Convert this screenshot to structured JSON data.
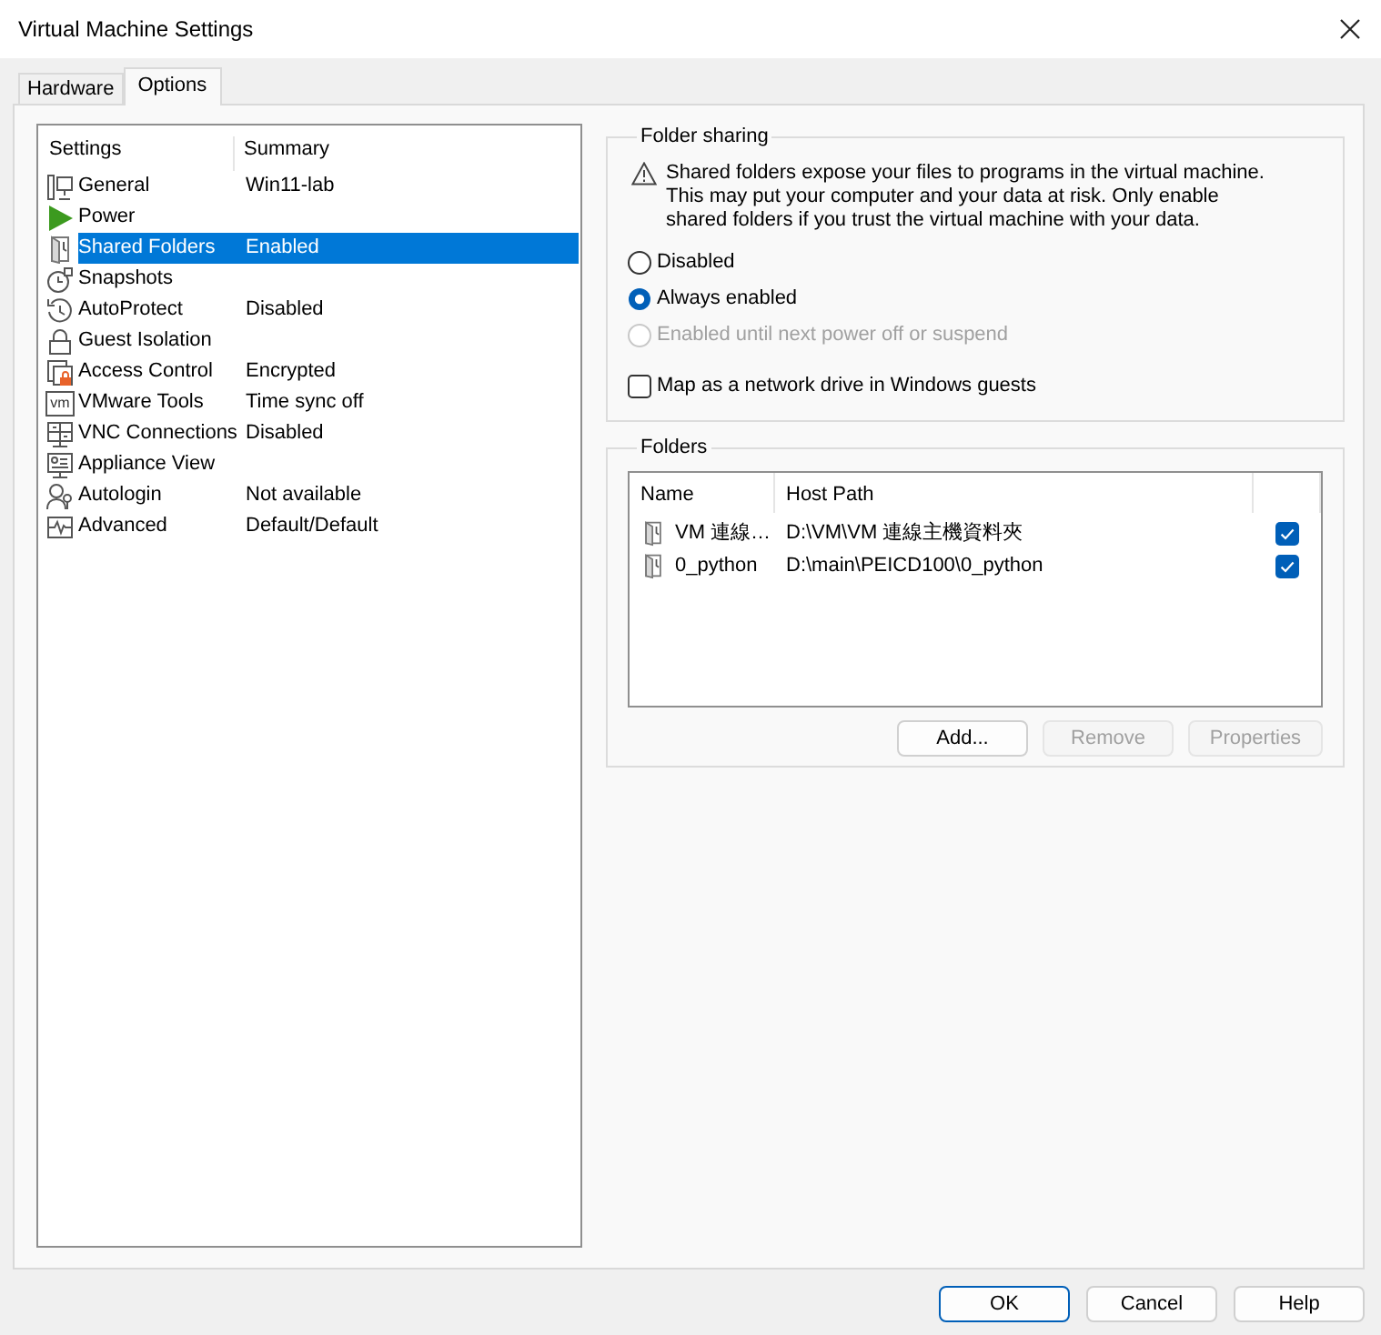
{
  "window": {
    "title": "Virtual Machine Settings"
  },
  "tabs": [
    {
      "label": "Hardware",
      "selected": false
    },
    {
      "label": "Options",
      "selected": true
    }
  ],
  "settings_list": {
    "columns": [
      "Settings",
      "Summary"
    ],
    "items": [
      {
        "kind": "monitor",
        "name": "General",
        "summary": "Win11-lab",
        "selected": false
      },
      {
        "kind": "power",
        "name": "Power",
        "selected": false
      },
      {
        "kind": "folder",
        "name": "Shared Folders",
        "summary": "Enabled",
        "selected": true
      },
      {
        "kind": "snapshot",
        "name": "Snapshots",
        "selected": false
      },
      {
        "kind": "autoprotect",
        "name": "AutoProtect",
        "summary": "Disabled",
        "selected": false
      },
      {
        "kind": "lock",
        "name": "Guest Isolation",
        "selected": false
      },
      {
        "kind": "access",
        "name": "Access Control",
        "summary": "Encrypted",
        "selected": false
      },
      {
        "kind": "tools",
        "name": "VMware Tools",
        "summary": "Time sync off",
        "icon_text": "vm",
        "selected": false
      },
      {
        "kind": "vnc",
        "name": "VNC Connections",
        "summary": "Disabled",
        "selected": false
      },
      {
        "kind": "appliance",
        "name": "Appliance View",
        "selected": false
      },
      {
        "kind": "autologin",
        "name": "Autologin",
        "summary": "Not available",
        "selected": false
      },
      {
        "kind": "advanced",
        "name": "Advanced",
        "summary": "Default/Default",
        "selected": false
      }
    ]
  },
  "folder_sharing": {
    "title": "Folder sharing",
    "warning": "Shared folders expose your files to programs in the virtual machine. This may put your computer and your data at risk. Only enable shared folders if you trust the virtual machine with your data.",
    "options": [
      {
        "label": "Disabled",
        "selected": false,
        "disabled": false
      },
      {
        "label": "Always enabled",
        "selected": true,
        "disabled": false
      },
      {
        "label": "Enabled until next power off or suspend",
        "selected": false,
        "disabled": true
      }
    ],
    "map_drive": {
      "label": "Map as a network drive in Windows guests",
      "checked": false
    }
  },
  "folders": {
    "title": "Folders",
    "columns": [
      "Name",
      "Host Path"
    ],
    "rows": [
      {
        "name": "VM 連線…",
        "host_path": "D:\\VM\\VM 連線主機資料夾",
        "checked": true
      },
      {
        "name": "0_python",
        "host_path": "D:\\main\\PEICD100\\0_python",
        "checked": true
      }
    ],
    "buttons": [
      {
        "label": "Add...",
        "disabled": false
      },
      {
        "label": "Remove",
        "disabled": true
      },
      {
        "label": "Properties",
        "disabled": true
      }
    ]
  },
  "footer_buttons": [
    {
      "label": "OK",
      "default": true
    },
    {
      "label": "Cancel",
      "default": false
    },
    {
      "label": "Help",
      "default": false
    }
  ]
}
